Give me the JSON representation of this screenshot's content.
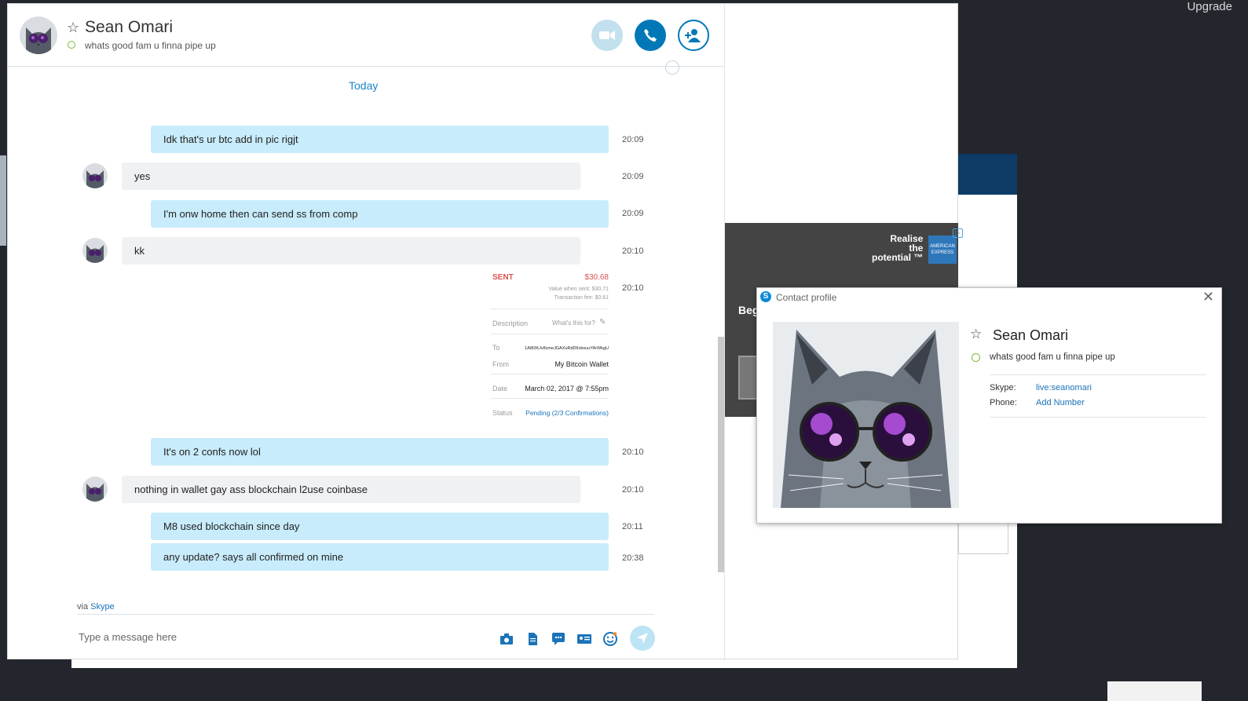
{
  "desktop": {
    "upgrade_label": "Upgrade"
  },
  "conversation": {
    "contact_name": "Sean Omari",
    "mood_message": "whats good fam u finna pipe up",
    "date_divider": "Today"
  },
  "messages": [
    {
      "sender": "me",
      "text": "Idk that's ur btc add in pic rigjt",
      "time": "20:09"
    },
    {
      "sender": "them",
      "text": "yes",
      "time": "20:09"
    },
    {
      "sender": "me",
      "text": "I'm onw home then can send ss from comp",
      "time": "20:09"
    },
    {
      "sender": "them",
      "text": "kk",
      "time": "20:10"
    },
    {
      "sender": "me",
      "text": "It's on 2 confs now lol",
      "time": "20:10"
    },
    {
      "sender": "them",
      "text": "nothing in wallet gay ass blockchain l2use coinbase",
      "time": "20:10"
    },
    {
      "sender": "me",
      "text": "M8 used blockchain since day",
      "time": "20:11"
    },
    {
      "sender": "me",
      "text": "any update? says all confirmed on mine",
      "time": "20:38"
    }
  ],
  "receipt": {
    "time": "20:10",
    "status_word": "SENT",
    "amount": "$30.68",
    "value_when_sent": "Value when sent: $30.71",
    "fee": "Transaction fee: $0.61",
    "description_label": "Description",
    "description_placeholder": "What's this for?",
    "to_label": "To",
    "to_value": "1A8t3KJv8zmeJGAXuRdD6vbsuuYArWkgU",
    "from_label": "From",
    "from_value": "My Bitcoin Wallet",
    "date_label": "Date",
    "date_value": "March 02, 2017 @ 7:55pm",
    "status_label": "Status",
    "status_value": "Pending (2/3 Confirmations)"
  },
  "composer": {
    "via_label": "via",
    "via_link": "Skype",
    "placeholder": "Type a message here"
  },
  "ad": {
    "line1": "Realise",
    "line2": "the",
    "line3": "potential ™",
    "partial_text": "Beg",
    "logo_text": "AMERICAN EXPRESS"
  },
  "profile": {
    "title": "Contact profile",
    "name": "Sean Omari",
    "mood": "whats good fam u finna pipe up",
    "skype_label": "Skype:",
    "skype_value": "live:seanomari",
    "phone_label": "Phone:",
    "phone_value": "Add Number"
  },
  "colors": {
    "accent": "#0078b8",
    "my_bubble": "#c8ecfb",
    "their_bubble": "#f0f1f3",
    "presence": "#7dbb3b",
    "sent_red": "#d9534f"
  }
}
